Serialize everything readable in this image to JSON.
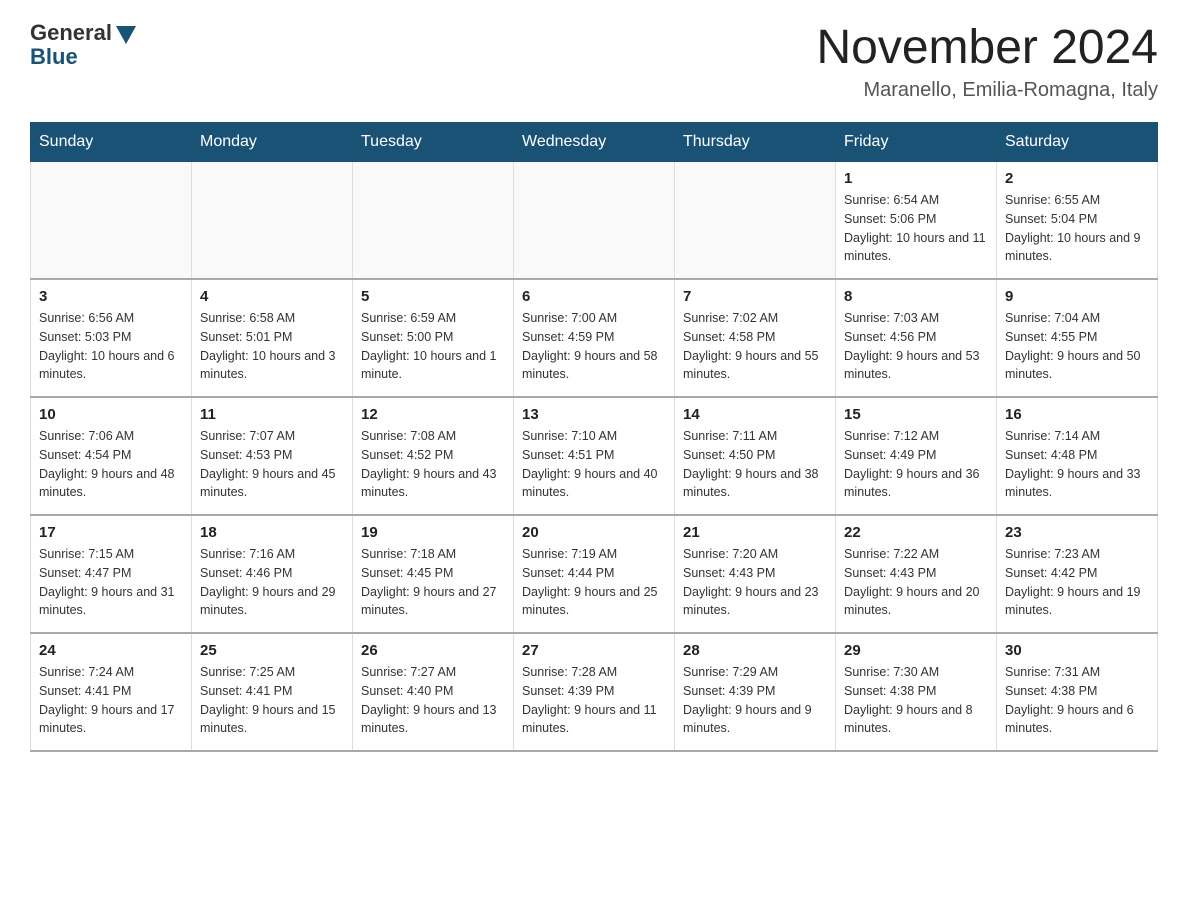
{
  "header": {
    "logo_general": "General",
    "logo_blue": "Blue",
    "month_title": "November 2024",
    "location": "Maranello, Emilia-Romagna, Italy"
  },
  "days_of_week": [
    "Sunday",
    "Monday",
    "Tuesday",
    "Wednesday",
    "Thursday",
    "Friday",
    "Saturday"
  ],
  "weeks": [
    [
      {
        "day": "",
        "sunrise": "",
        "sunset": "",
        "daylight": ""
      },
      {
        "day": "",
        "sunrise": "",
        "sunset": "",
        "daylight": ""
      },
      {
        "day": "",
        "sunrise": "",
        "sunset": "",
        "daylight": ""
      },
      {
        "day": "",
        "sunrise": "",
        "sunset": "",
        "daylight": ""
      },
      {
        "day": "",
        "sunrise": "",
        "sunset": "",
        "daylight": ""
      },
      {
        "day": "1",
        "sunrise": "Sunrise: 6:54 AM",
        "sunset": "Sunset: 5:06 PM",
        "daylight": "Daylight: 10 hours and 11 minutes."
      },
      {
        "day": "2",
        "sunrise": "Sunrise: 6:55 AM",
        "sunset": "Sunset: 5:04 PM",
        "daylight": "Daylight: 10 hours and 9 minutes."
      }
    ],
    [
      {
        "day": "3",
        "sunrise": "Sunrise: 6:56 AM",
        "sunset": "Sunset: 5:03 PM",
        "daylight": "Daylight: 10 hours and 6 minutes."
      },
      {
        "day": "4",
        "sunrise": "Sunrise: 6:58 AM",
        "sunset": "Sunset: 5:01 PM",
        "daylight": "Daylight: 10 hours and 3 minutes."
      },
      {
        "day": "5",
        "sunrise": "Sunrise: 6:59 AM",
        "sunset": "Sunset: 5:00 PM",
        "daylight": "Daylight: 10 hours and 1 minute."
      },
      {
        "day": "6",
        "sunrise": "Sunrise: 7:00 AM",
        "sunset": "Sunset: 4:59 PM",
        "daylight": "Daylight: 9 hours and 58 minutes."
      },
      {
        "day": "7",
        "sunrise": "Sunrise: 7:02 AM",
        "sunset": "Sunset: 4:58 PM",
        "daylight": "Daylight: 9 hours and 55 minutes."
      },
      {
        "day": "8",
        "sunrise": "Sunrise: 7:03 AM",
        "sunset": "Sunset: 4:56 PM",
        "daylight": "Daylight: 9 hours and 53 minutes."
      },
      {
        "day": "9",
        "sunrise": "Sunrise: 7:04 AM",
        "sunset": "Sunset: 4:55 PM",
        "daylight": "Daylight: 9 hours and 50 minutes."
      }
    ],
    [
      {
        "day": "10",
        "sunrise": "Sunrise: 7:06 AM",
        "sunset": "Sunset: 4:54 PM",
        "daylight": "Daylight: 9 hours and 48 minutes."
      },
      {
        "day": "11",
        "sunrise": "Sunrise: 7:07 AM",
        "sunset": "Sunset: 4:53 PM",
        "daylight": "Daylight: 9 hours and 45 minutes."
      },
      {
        "day": "12",
        "sunrise": "Sunrise: 7:08 AM",
        "sunset": "Sunset: 4:52 PM",
        "daylight": "Daylight: 9 hours and 43 minutes."
      },
      {
        "day": "13",
        "sunrise": "Sunrise: 7:10 AM",
        "sunset": "Sunset: 4:51 PM",
        "daylight": "Daylight: 9 hours and 40 minutes."
      },
      {
        "day": "14",
        "sunrise": "Sunrise: 7:11 AM",
        "sunset": "Sunset: 4:50 PM",
        "daylight": "Daylight: 9 hours and 38 minutes."
      },
      {
        "day": "15",
        "sunrise": "Sunrise: 7:12 AM",
        "sunset": "Sunset: 4:49 PM",
        "daylight": "Daylight: 9 hours and 36 minutes."
      },
      {
        "day": "16",
        "sunrise": "Sunrise: 7:14 AM",
        "sunset": "Sunset: 4:48 PM",
        "daylight": "Daylight: 9 hours and 33 minutes."
      }
    ],
    [
      {
        "day": "17",
        "sunrise": "Sunrise: 7:15 AM",
        "sunset": "Sunset: 4:47 PM",
        "daylight": "Daylight: 9 hours and 31 minutes."
      },
      {
        "day": "18",
        "sunrise": "Sunrise: 7:16 AM",
        "sunset": "Sunset: 4:46 PM",
        "daylight": "Daylight: 9 hours and 29 minutes."
      },
      {
        "day": "19",
        "sunrise": "Sunrise: 7:18 AM",
        "sunset": "Sunset: 4:45 PM",
        "daylight": "Daylight: 9 hours and 27 minutes."
      },
      {
        "day": "20",
        "sunrise": "Sunrise: 7:19 AM",
        "sunset": "Sunset: 4:44 PM",
        "daylight": "Daylight: 9 hours and 25 minutes."
      },
      {
        "day": "21",
        "sunrise": "Sunrise: 7:20 AM",
        "sunset": "Sunset: 4:43 PM",
        "daylight": "Daylight: 9 hours and 23 minutes."
      },
      {
        "day": "22",
        "sunrise": "Sunrise: 7:22 AM",
        "sunset": "Sunset: 4:43 PM",
        "daylight": "Daylight: 9 hours and 20 minutes."
      },
      {
        "day": "23",
        "sunrise": "Sunrise: 7:23 AM",
        "sunset": "Sunset: 4:42 PM",
        "daylight": "Daylight: 9 hours and 19 minutes."
      }
    ],
    [
      {
        "day": "24",
        "sunrise": "Sunrise: 7:24 AM",
        "sunset": "Sunset: 4:41 PM",
        "daylight": "Daylight: 9 hours and 17 minutes."
      },
      {
        "day": "25",
        "sunrise": "Sunrise: 7:25 AM",
        "sunset": "Sunset: 4:41 PM",
        "daylight": "Daylight: 9 hours and 15 minutes."
      },
      {
        "day": "26",
        "sunrise": "Sunrise: 7:27 AM",
        "sunset": "Sunset: 4:40 PM",
        "daylight": "Daylight: 9 hours and 13 minutes."
      },
      {
        "day": "27",
        "sunrise": "Sunrise: 7:28 AM",
        "sunset": "Sunset: 4:39 PM",
        "daylight": "Daylight: 9 hours and 11 minutes."
      },
      {
        "day": "28",
        "sunrise": "Sunrise: 7:29 AM",
        "sunset": "Sunset: 4:39 PM",
        "daylight": "Daylight: 9 hours and 9 minutes."
      },
      {
        "day": "29",
        "sunrise": "Sunrise: 7:30 AM",
        "sunset": "Sunset: 4:38 PM",
        "daylight": "Daylight: 9 hours and 8 minutes."
      },
      {
        "day": "30",
        "sunrise": "Sunrise: 7:31 AM",
        "sunset": "Sunset: 4:38 PM",
        "daylight": "Daylight: 9 hours and 6 minutes."
      }
    ]
  ]
}
